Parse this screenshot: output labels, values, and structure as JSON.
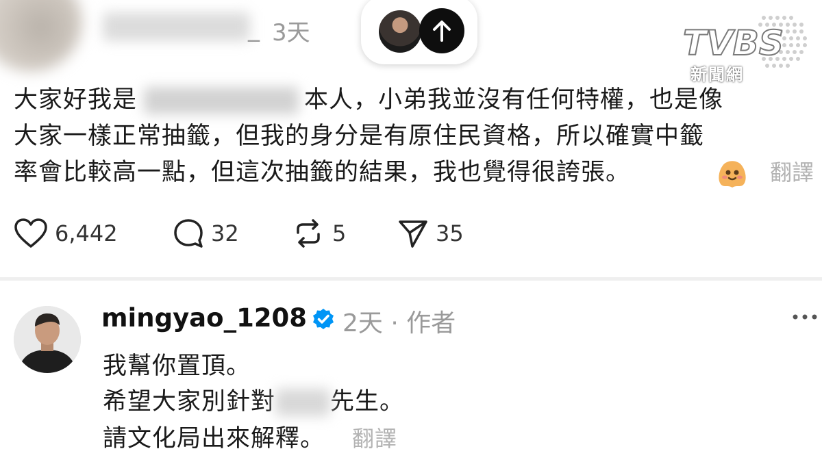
{
  "top_post": {
    "username_suffix": "_",
    "time": "3天",
    "text_before_name": "大家好我是",
    "text_after_name": "本人，小弟我並沒有任何特權，也是像",
    "line2": "大家一樣正常抽籤，但我的身分是有原住民資格，所以確實中籤",
    "line3": "率會比較高一點，但這次抽籤的結果，我也覺得很誇張。",
    "translate": "翻譯",
    "likes": "6,442",
    "comments": "32",
    "reposts": "5",
    "shares": "35"
  },
  "watermark": {
    "sub": "新聞網"
  },
  "reply": {
    "username": "mingyao_1208",
    "meta": "2天 · 作者",
    "line1": "我幫你置頂。",
    "line2_before": "希望大家別針對",
    "line2_after": "先生。",
    "line3": "請文化局出來解釋。",
    "translate": "翻譯"
  },
  "colors": {
    "verified": "#0095f6",
    "muted_text": "#9a9a9a"
  }
}
